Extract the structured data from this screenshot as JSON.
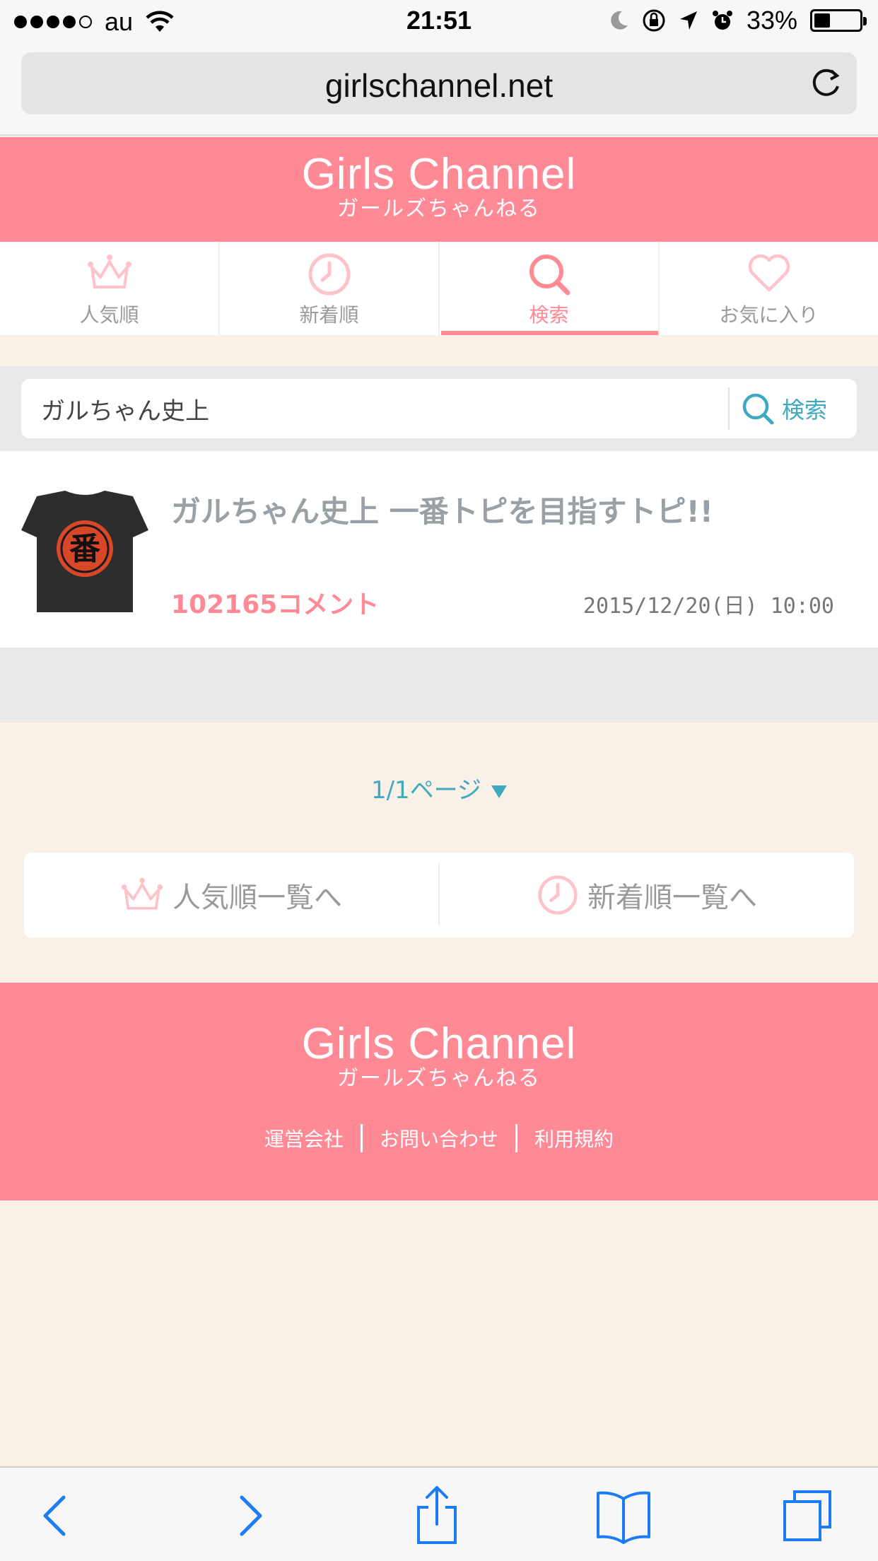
{
  "status_bar": {
    "carrier": "au",
    "time": "21:51",
    "battery": "33%",
    "signal_bars_filled": 4,
    "signal_bars_total": 5
  },
  "browser": {
    "url": "girlschannel.net"
  },
  "header": {
    "logo": "Girls Channel",
    "logo_kana": "ガールズちゃんねる"
  },
  "tabs": [
    {
      "label": "人気順",
      "icon": "crown-icon",
      "active": false
    },
    {
      "label": "新着順",
      "icon": "clock-icon",
      "active": false
    },
    {
      "label": "検索",
      "icon": "search-icon",
      "active": true
    },
    {
      "label": "お気に入り",
      "icon": "heart-icon",
      "active": false
    }
  ],
  "search": {
    "value": "ガルちゃん史上",
    "button_label": "検索"
  },
  "result": {
    "title": "ガルちゃん史上 一番トピを目指すトピ!!",
    "comments": "102165コメント",
    "date": "2015/12/20(日) 10:00",
    "thumbnail_text": "番"
  },
  "pager": {
    "label": "1/1ページ"
  },
  "links": {
    "popular": "人気順一覧へ",
    "newest": "新着順一覧へ"
  },
  "footer": {
    "logo": "Girls Channel",
    "logo_kana": "ガールズちゃんねる",
    "links": [
      "運営会社",
      "お問い合わせ",
      "利用規約"
    ]
  },
  "colors": {
    "brand_pink": "#ff8a96",
    "accent_blue": "#3ea9c1",
    "page_bg": "#f9f0e7"
  }
}
